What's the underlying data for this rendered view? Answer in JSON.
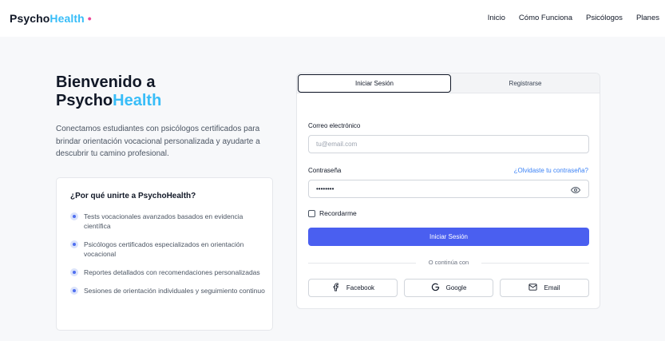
{
  "brand": {
    "part1": "Psycho",
    "part2": "Health",
    "dot": "•"
  },
  "nav": {
    "items": [
      "Inicio",
      "Cómo Funciona",
      "Psicólogos",
      "Planes"
    ]
  },
  "hero": {
    "title_line1": "Bienvenido a",
    "title_line2_a": "Psycho",
    "title_line2_b": "Health",
    "description": "Conectamos estudiantes con psicólogos certificados para brindar orientación vocacional personalizada y ayudarte a descubrir tu camino profesional."
  },
  "why": {
    "title": "¿Por qué unirte a PsychoHealth?",
    "items": [
      "Tests vocacionales avanzados basados en evidencia científica",
      "Psicólogos certificados especializados en orientación vocacional",
      "Reportes detallados con recomendaciones personalizadas",
      "Sesiones de orientación individuales y seguimiento continuo"
    ]
  },
  "auth": {
    "tab_login": "Iniciar Sesión",
    "tab_register": "Registrarse",
    "email_label": "Correo electrónico",
    "email_placeholder": "tu@email.com",
    "password_label": "Contraseña",
    "forgot": "¿Olvidaste tu contraseña?",
    "password_value": "••••••••",
    "remember": "Recordarme",
    "submit": "Iniciar Sesión",
    "divider": "O continúa con",
    "social": {
      "facebook": "Facebook",
      "google": "Google",
      "email": "Email"
    }
  },
  "colors": {
    "accent": "#38bdf8",
    "brand_dot": "#ec4899",
    "primary_button": "#4a5ff0",
    "link": "#3b82f6"
  }
}
